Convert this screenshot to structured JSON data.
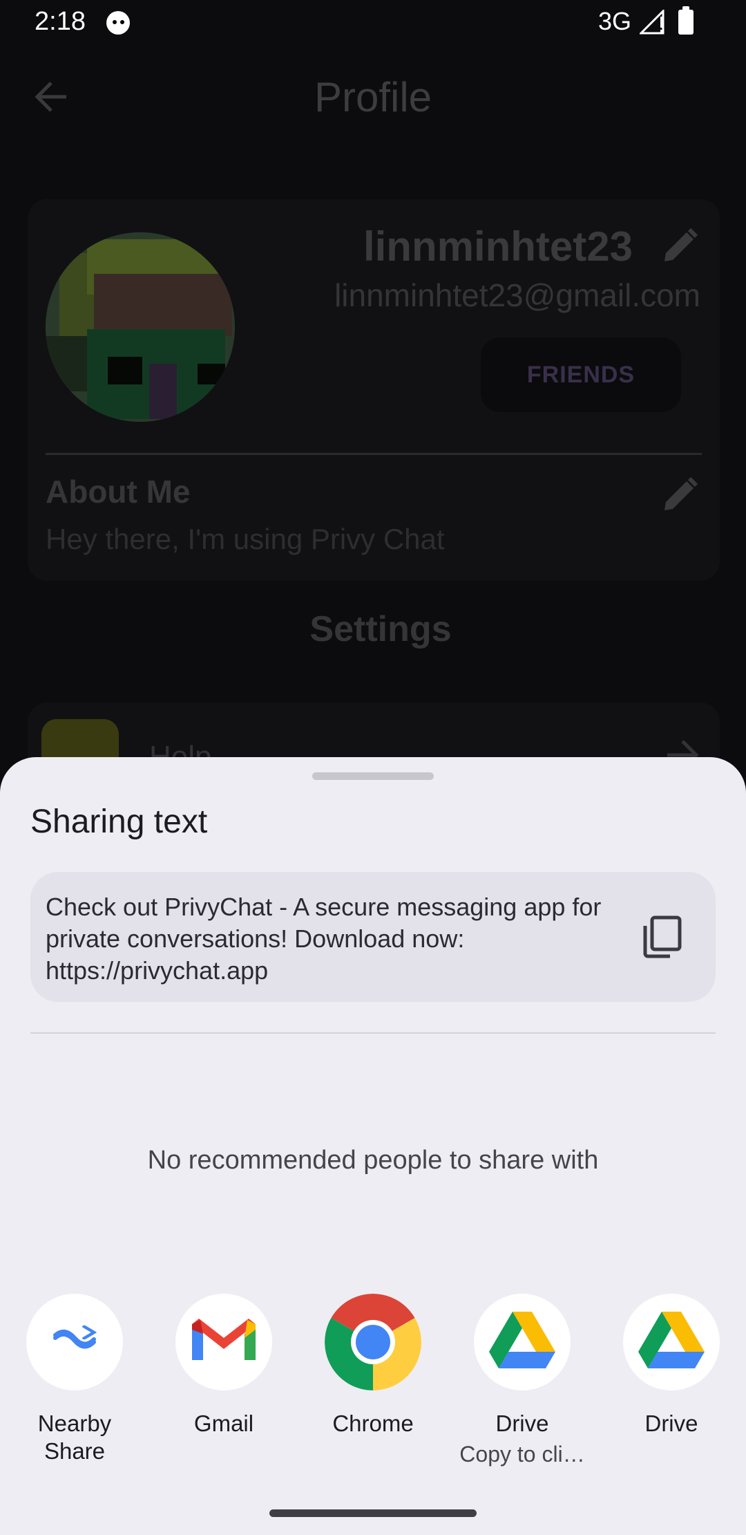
{
  "status_bar": {
    "time": "2:18",
    "network": "3G"
  },
  "app": {
    "title": "Profile",
    "profile": {
      "username": "linnminhtet23",
      "email": "linnminhtet23@gmail.com",
      "friends_label": "FRIENDS",
      "about_title": "About Me",
      "about_text": "Hey there, I'm using Privy Chat"
    },
    "settings_title": "Settings",
    "settings_items": [
      {
        "label": "Help",
        "icon": "help-icon"
      }
    ]
  },
  "share_sheet": {
    "title": "Sharing text",
    "preview_text": "Check out PrivyChat - A secure messaging app for private conversations! Download now: https://privychat.app",
    "empty_message": "No recommended people to share with",
    "targets": [
      {
        "label": "Nearby Share",
        "sublabel": "",
        "icon": "nearby-share-icon"
      },
      {
        "label": "Gmail",
        "sublabel": "",
        "icon": "gmail-icon"
      },
      {
        "label": "Chrome",
        "sublabel": "",
        "icon": "chrome-icon"
      },
      {
        "label": "Drive",
        "sublabel": "Copy to cli…",
        "icon": "drive-icon"
      },
      {
        "label": "Drive",
        "sublabel": "",
        "icon": "drive-icon"
      }
    ]
  },
  "colors": {
    "sheet_background": "#eeedf3",
    "preview_background": "#e3e2ea",
    "dim_background": "#0c0c0f",
    "friends_text": "#3a2f4b"
  }
}
